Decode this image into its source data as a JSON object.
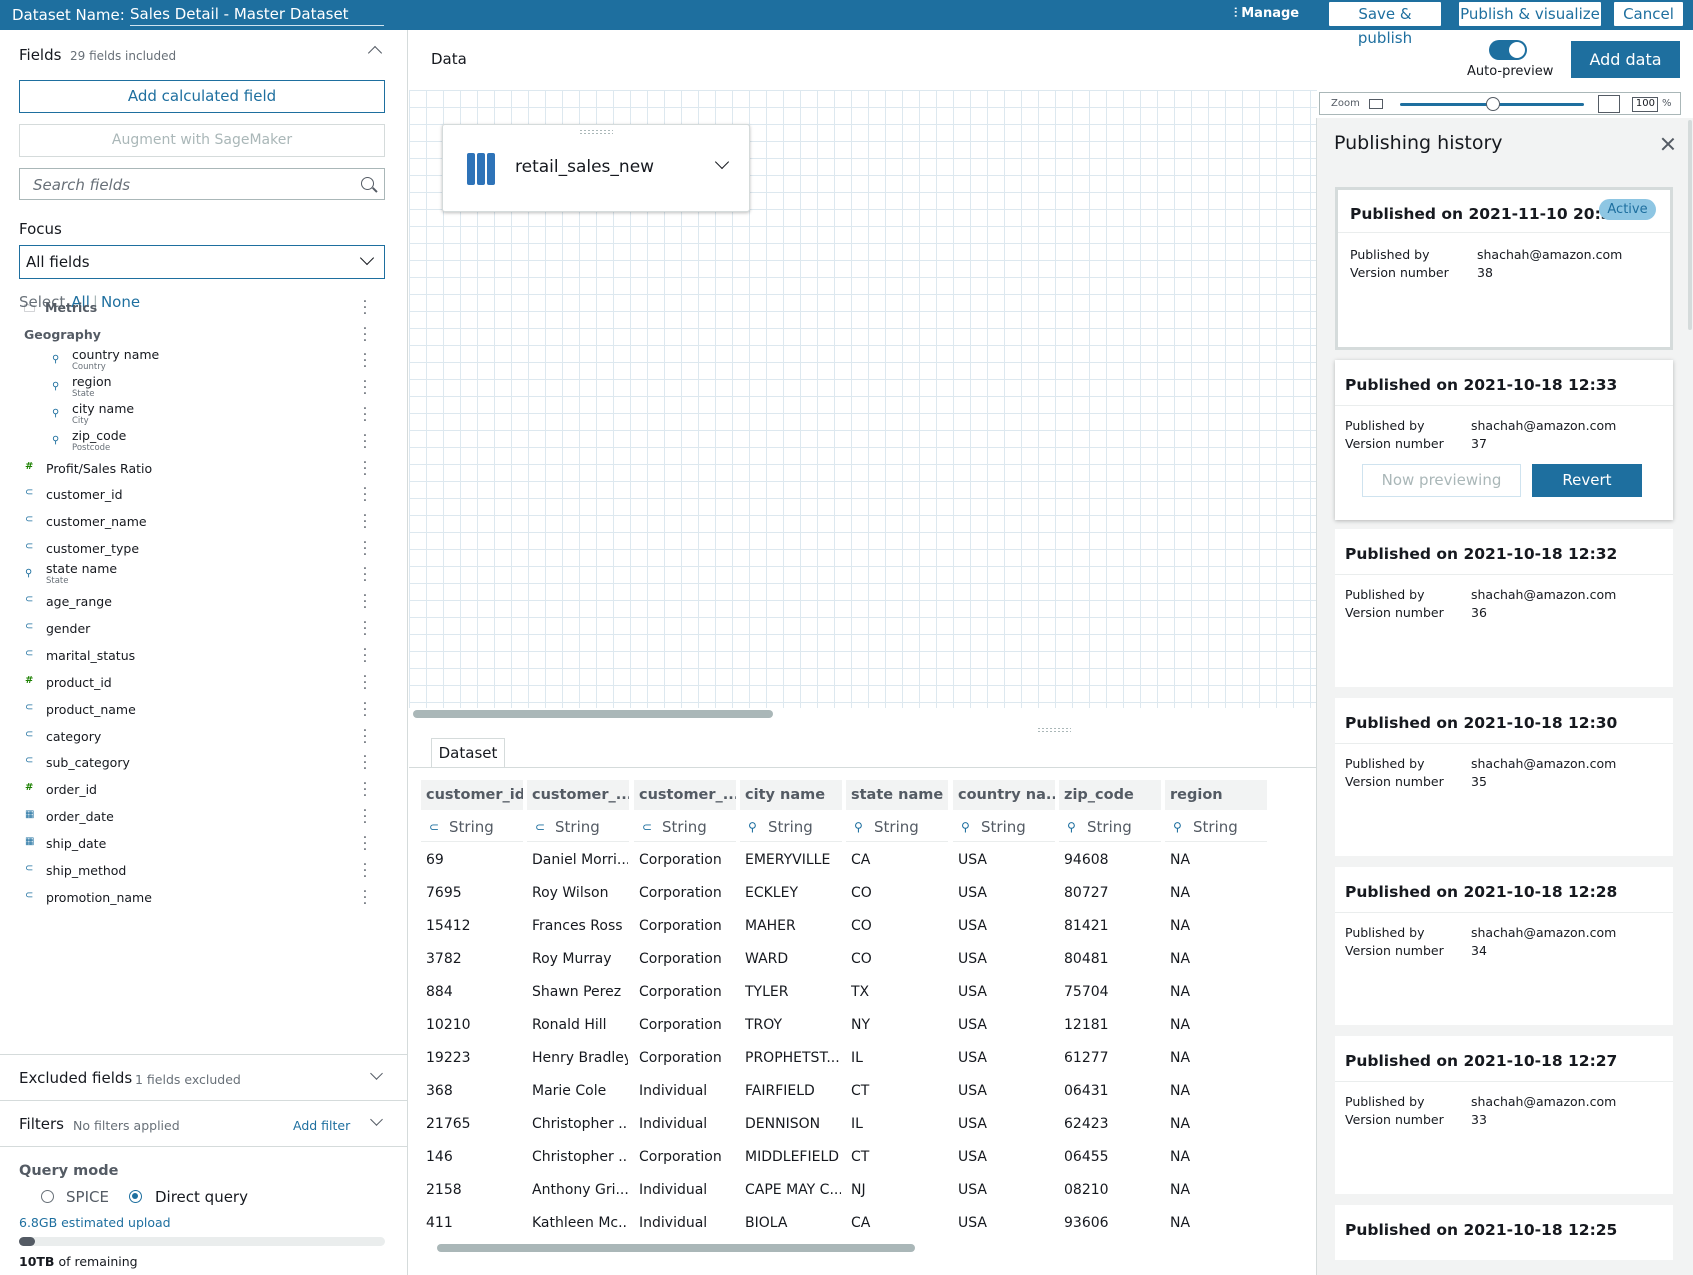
{
  "topbar": {
    "dataset_label": "Dataset Name:",
    "dataset_name": "Sales Detail - Master Dataset",
    "manage": "Manage",
    "save_publish": "Save & publish",
    "publish_visualize": "Publish & visualize",
    "cancel": "Cancel"
  },
  "fields": {
    "title": "Fields",
    "count": "29 fields included",
    "add_calculated": "Add calculated field",
    "augment": "Augment with SageMaker",
    "search_placeholder": "Search fields",
    "focus_label": "Focus",
    "focus_value": "All fields",
    "select_label": "Select",
    "select_all": "All",
    "select_none": "None",
    "items": [
      {
        "name": "Metrics",
        "sub": "",
        "icon": "folder-icon"
      },
      {
        "name": "Geography",
        "sub": "",
        "icon": "none"
      },
      {
        "name": "country name",
        "sub": "Country",
        "icon": "geo-pin-icon"
      },
      {
        "name": "region",
        "sub": "State",
        "icon": "geo-pin-icon"
      },
      {
        "name": "city name",
        "sub": "City",
        "icon": "geo-pin-icon"
      },
      {
        "name": "zip_code",
        "sub": "Postcode",
        "icon": "geo-pin-icon"
      },
      {
        "name": "Profit/Sales Ratio",
        "sub": "",
        "icon": "number-icon"
      },
      {
        "name": "customer_id",
        "sub": "",
        "icon": "string-tag-icon"
      },
      {
        "name": "customer_name",
        "sub": "",
        "icon": "string-tag-icon"
      },
      {
        "name": "customer_type",
        "sub": "",
        "icon": "string-tag-icon"
      },
      {
        "name": "state name",
        "sub": "State",
        "icon": "geo-pin-icon"
      },
      {
        "name": "age_range",
        "sub": "",
        "icon": "string-tag-icon"
      },
      {
        "name": "gender",
        "sub": "",
        "icon": "string-tag-icon"
      },
      {
        "name": "marital_status",
        "sub": "",
        "icon": "string-tag-icon"
      },
      {
        "name": "product_id",
        "sub": "",
        "icon": "number-icon"
      },
      {
        "name": "product_name",
        "sub": "",
        "icon": "string-tag-icon"
      },
      {
        "name": "category",
        "sub": "",
        "icon": "string-tag-icon"
      },
      {
        "name": "sub_category",
        "sub": "",
        "icon": "string-tag-icon"
      },
      {
        "name": "order_id",
        "sub": "",
        "icon": "number-icon"
      },
      {
        "name": "order_date",
        "sub": "",
        "icon": "calendar-icon"
      },
      {
        "name": "ship_date",
        "sub": "",
        "icon": "calendar-icon"
      },
      {
        "name": "ship_method",
        "sub": "",
        "icon": "string-tag-icon"
      },
      {
        "name": "promotion_name",
        "sub": "",
        "icon": "string-tag-icon"
      }
    ]
  },
  "excluded": {
    "title": "Excluded fields",
    "count": "1 fields excluded"
  },
  "filters": {
    "title": "Filters",
    "status": "No filters applied",
    "add": "Add filter"
  },
  "query_mode": {
    "title": "Query mode",
    "spice": "SPICE",
    "direct": "Direct query",
    "estimate": "6.8GB estimated upload",
    "remaining_value": "10TB",
    "remaining_text": "of remaining",
    "usage_fraction": 0.045
  },
  "data": {
    "title": "Data",
    "auto_preview": "Auto-preview",
    "add_data": "Add data",
    "node_label": "retail_sales_new",
    "zoom_label": "Zoom",
    "zoom_value": "100",
    "zoom_unit": "%"
  },
  "grid": {
    "tab": "Dataset",
    "columns": [
      {
        "header": "customer_id",
        "type": "String",
        "type_icon": "string-tag-icon"
      },
      {
        "header": "customer_...",
        "type": "String",
        "type_icon": "string-tag-icon"
      },
      {
        "header": "customer_...",
        "type": "String",
        "type_icon": "string-tag-icon"
      },
      {
        "header": "city name",
        "type": "String",
        "type_icon": "geo-pin-icon"
      },
      {
        "header": "state name",
        "type": "String",
        "type_icon": "geo-pin-icon"
      },
      {
        "header": "country na...",
        "type": "String",
        "type_icon": "geo-pin-icon"
      },
      {
        "header": "zip_code",
        "type": "String",
        "type_icon": "geo-pin-icon"
      },
      {
        "header": "region",
        "type": "String",
        "type_icon": "geo-pin-icon"
      }
    ],
    "rows": [
      [
        "69",
        "Daniel Morri...",
        "Corporation",
        "EMERYVILLE",
        "CA",
        "USA",
        "94608",
        "NA"
      ],
      [
        "7695",
        "Roy Wilson",
        "Corporation",
        "ECKLEY",
        "CO",
        "USA",
        "80727",
        "NA"
      ],
      [
        "15412",
        "Frances Ross",
        "Corporation",
        "MAHER",
        "CO",
        "USA",
        "81421",
        "NA"
      ],
      [
        "3782",
        "Roy Murray",
        "Corporation",
        "WARD",
        "CO",
        "USA",
        "80481",
        "NA"
      ],
      [
        "884",
        "Shawn Perez",
        "Corporation",
        "TYLER",
        "TX",
        "USA",
        "75704",
        "NA"
      ],
      [
        "10210",
        "Ronald Hill",
        "Corporation",
        "TROY",
        "NY",
        "USA",
        "12181",
        "NA"
      ],
      [
        "19223",
        "Henry Bradley",
        "Corporation",
        "PROPHETST...",
        "IL",
        "USA",
        "61277",
        "NA"
      ],
      [
        "368",
        "Marie Cole",
        "Individual",
        "FAIRFIELD",
        "CT",
        "USA",
        "06431",
        "NA"
      ],
      [
        "21765",
        "Christopher ...",
        "Individual",
        "DENNISON",
        "IL",
        "USA",
        "62423",
        "NA"
      ],
      [
        "146",
        "Christopher ...",
        "Corporation",
        "MIDDLEFIELD",
        "CT",
        "USA",
        "06455",
        "NA"
      ],
      [
        "2158",
        "Anthony Gri...",
        "Individual",
        "CAPE MAY C...",
        "NJ",
        "USA",
        "08210",
        "NA"
      ],
      [
        "411",
        "Kathleen Mc...",
        "Individual",
        "BIOLA",
        "CA",
        "USA",
        "93606",
        "NA"
      ]
    ]
  },
  "history": {
    "title": "Publishing history",
    "active_badge": "Active",
    "published_by_label": "Published by",
    "version_label": "Version number",
    "now_previewing": "Now previewing",
    "revert": "Revert",
    "entries": [
      {
        "title": "Published on 2021-11-10 20:36",
        "by": "shachah@amazon.com",
        "version": "38"
      },
      {
        "title": "Published on 2021-10-18 12:33",
        "by": "shachah@amazon.com",
        "version": "37"
      },
      {
        "title": "Published on 2021-10-18 12:32",
        "by": "shachah@amazon.com",
        "version": "36"
      },
      {
        "title": "Published on 2021-10-18 12:30",
        "by": "shachah@amazon.com",
        "version": "35"
      },
      {
        "title": "Published on 2021-10-18 12:28",
        "by": "shachah@amazon.com",
        "version": "34"
      },
      {
        "title": "Published on 2021-10-18 12:27",
        "by": "shachah@amazon.com",
        "version": "33"
      },
      {
        "title": "Published on 2021-10-18 12:25",
        "by": "",
        "version": ""
      }
    ]
  }
}
